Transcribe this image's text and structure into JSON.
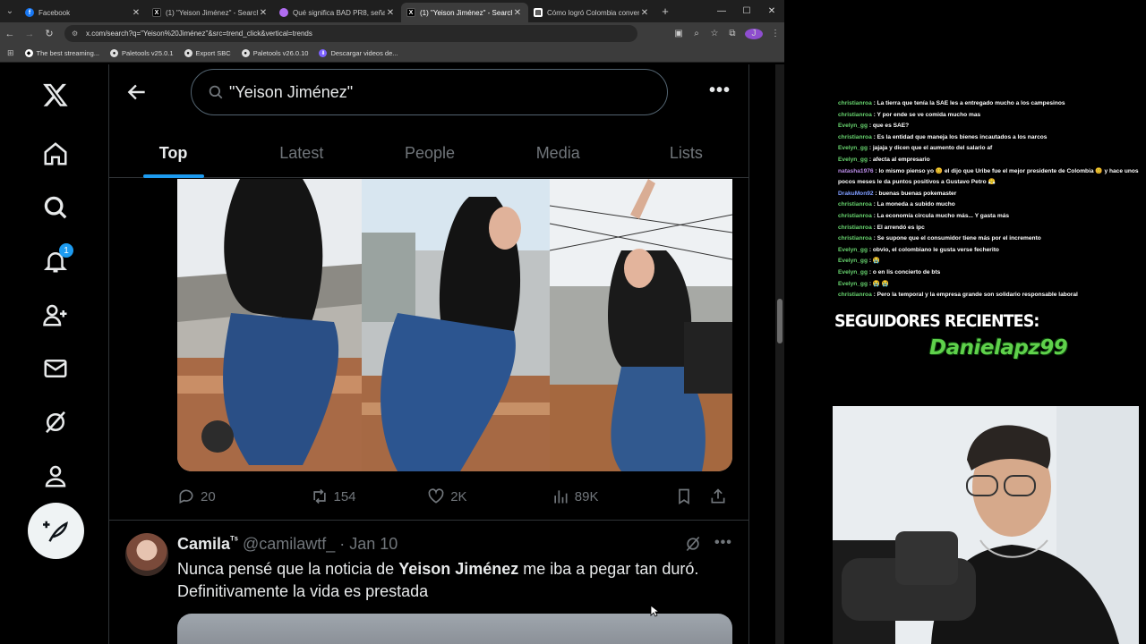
{
  "browser": {
    "tabs": [
      {
        "title": "Facebook",
        "icon": "facebook-icon",
        "color": "#1877f2"
      },
      {
        "title": "(1) \"Yeison Jiménez\" - Search /",
        "icon": "x-icon",
        "color": "#000000"
      },
      {
        "title": "Qué significa BAD PR8, señal q",
        "icon": "gemini-icon",
        "color": "#b06cf0"
      },
      {
        "title": "(1) \"Yeison Jiménez\" - Search /",
        "icon": "x-icon",
        "color": "#000000",
        "active": true
      },
      {
        "title": "Cómo logró Colombia converti",
        "icon": "doc-icon",
        "color": "#ffffff"
      }
    ],
    "url": "x.com/search?q=\"Yeison%20Jiménez\"&src=trend_click&vertical=trends",
    "profile_initial": "J",
    "bookmarks": [
      {
        "label": "The best streaming..."
      },
      {
        "label": "Paletools v25.0.1"
      },
      {
        "label": "Export SBC"
      },
      {
        "label": "Paletools v26.0.10"
      },
      {
        "label": "Descargar videos de..."
      }
    ]
  },
  "x": {
    "nav": {
      "notification_count": "1"
    },
    "search": {
      "query": "\"Yeison Jiménez\""
    },
    "tabs": [
      "Top",
      "Latest",
      "People",
      "Media",
      "Lists"
    ],
    "selected_tab": "Top",
    "tweet1": {
      "replies": "20",
      "reposts": "154",
      "likes": "2K",
      "views": "89K"
    },
    "tweet2": {
      "name": "Camila",
      "name_suffix": "ᵀˢ",
      "handle": "@camilawtf_",
      "date": "· Jan 10",
      "text_before": "Nunca pensé que la noticia de ",
      "text_bold": "Yeison Jiménez",
      "text_after": " me iba a pegar tan duró. Definitivamente la vida es prestada"
    }
  },
  "stream": {
    "chat": [
      {
        "user": "christianroa",
        "color": "green",
        "msg": " : La tierra que tenía la SAE les a entregado mucho a los campesinos"
      },
      {
        "user": "christianroa",
        "color": "green",
        "msg": " : Y por ende se ve comida mucho mas"
      },
      {
        "user": "Evelyn_gg",
        "color": "green",
        "msg": " : que es SAE?"
      },
      {
        "user": "christianroa",
        "color": "green",
        "msg": " : Es la entidad que maneja los bienes incautados a los narcos"
      },
      {
        "user": "Evelyn_gg",
        "color": "green",
        "msg": " : jajaja y dicen que el aumento del salario af"
      },
      {
        "user": "Evelyn_gg",
        "color": "green",
        "msg": " : afecta al empresario"
      },
      {
        "user": "natasha1976",
        "color": "pink",
        "msg": " : lo mismo pienso yo 😊 el dijo que Uribe fue el mejor presidente de Colombia 😊 y hace unos pocos meses le da puntos positivos a Gustavo Petro 😤"
      },
      {
        "user": "DrakuMon92",
        "color": "blue",
        "msg": " : buenas buenas pokemaster"
      },
      {
        "user": "christianroa",
        "color": "green",
        "msg": " : La moneda a subido mucho"
      },
      {
        "user": "christianroa",
        "color": "green",
        "msg": " : La economía circula mucho más... Y gasta más"
      },
      {
        "user": "christianroa",
        "color": "green",
        "msg": " : El arrendó es ipc"
      },
      {
        "user": "christianroa",
        "color": "green",
        "msg": " : Se supone que el consumidor tiene más por el incremento"
      },
      {
        "user": "Evelyn_gg",
        "color": "green",
        "msg": " : obvio, el colombiano le gusta verse fecherito"
      },
      {
        "user": "Evelyn_gg",
        "color": "green",
        "msg": " : 😭"
      },
      {
        "user": "Evelyn_gg",
        "color": "green",
        "msg": " : o en lis concierto de bts"
      },
      {
        "user": "Evelyn_gg",
        "color": "green",
        "msg": " : 😭 😭"
      },
      {
        "user": "christianroa",
        "color": "green",
        "msg": " : Pero la temporal y la empresa grande son solidario responsable laboral"
      }
    ],
    "followers_label": "SEGUIDORES RECIENTES:",
    "latest_follower": "Danielapz99"
  }
}
